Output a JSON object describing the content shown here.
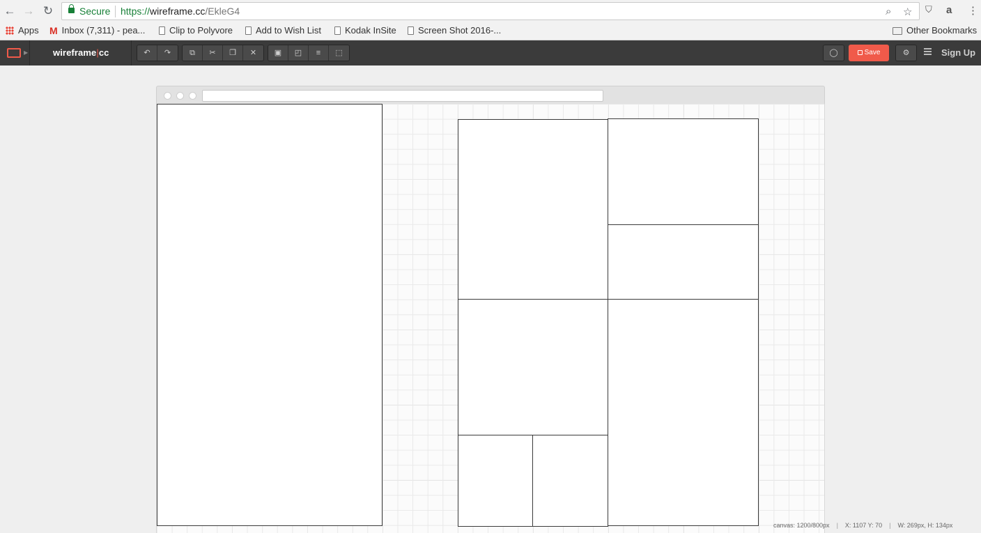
{
  "browser": {
    "secure_label": "Secure",
    "url_scheme": "https://",
    "url_host": "wireframe.cc",
    "url_path": "/EkleG4",
    "bookmarks": [
      {
        "label": "Apps",
        "icon": "apps-grid-icon"
      },
      {
        "label": "Inbox (7,311) - pea...",
        "icon": "gmail-icon"
      },
      {
        "label": "Clip to Polyvore",
        "icon": "page-icon"
      },
      {
        "label": "Add to Wish List",
        "icon": "page-icon"
      },
      {
        "label": "Kodak InSite",
        "icon": "page-icon"
      },
      {
        "label": "Screen Shot 2016-...",
        "icon": "page-icon"
      }
    ],
    "other_bookmarks": "Other Bookmarks"
  },
  "app": {
    "brand_left": "wireframe",
    "brand_bar": "|",
    "brand_right": "cc",
    "save_label": "Save",
    "signup_label": "Sign Up",
    "accent_color": "#f05a4a",
    "toolbar_icons": [
      "undo-icon",
      "redo-icon",
      "duplicate-icon",
      "cut-icon",
      "paste-icon",
      "delete-icon",
      "lock-icon",
      "arrange-icon",
      "align-icon",
      "group-icon"
    ]
  },
  "status": {
    "canvas": "canvas: 1200/800px",
    "position": "X: 1107 Y: 70",
    "size": "W: 269px, H: 134px"
  }
}
